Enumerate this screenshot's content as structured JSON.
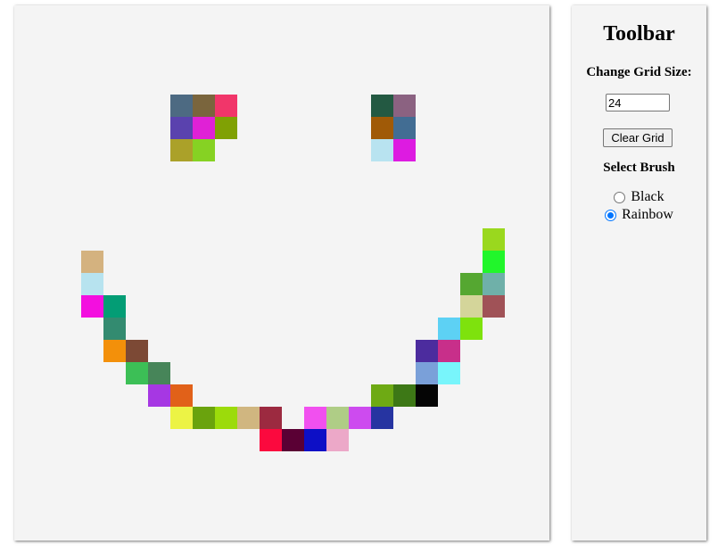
{
  "canvas": {
    "grid_size": 24,
    "background": "#f4f4f4",
    "painted_cells": [
      {
        "row": 4,
        "col": 7,
        "color": "#4d6a82"
      },
      {
        "row": 4,
        "col": 8,
        "color": "#7a653d"
      },
      {
        "row": 4,
        "col": 9,
        "color": "#f1366a"
      },
      {
        "row": 5,
        "col": 7,
        "color": "#5a42ae"
      },
      {
        "row": 5,
        "col": 8,
        "color": "#e021d6"
      },
      {
        "row": 5,
        "col": 9,
        "color": "#80a104"
      },
      {
        "row": 6,
        "col": 7,
        "color": "#aba129"
      },
      {
        "row": 6,
        "col": 8,
        "color": "#86d223"
      },
      {
        "row": 4,
        "col": 16,
        "color": "#235942"
      },
      {
        "row": 4,
        "col": 17,
        "color": "#8b6281"
      },
      {
        "row": 5,
        "col": 16,
        "color": "#a05a07"
      },
      {
        "row": 5,
        "col": 17,
        "color": "#426d93"
      },
      {
        "row": 6,
        "col": 16,
        "color": "#b8e3f0"
      },
      {
        "row": 6,
        "col": 17,
        "color": "#dd1be1"
      },
      {
        "row": 11,
        "col": 3,
        "color": "#d4b27f"
      },
      {
        "row": 12,
        "col": 3,
        "color": "#b7e3ef"
      },
      {
        "row": 13,
        "col": 3,
        "color": "#f30fdf"
      },
      {
        "row": 13,
        "col": 4,
        "color": "#039d75"
      },
      {
        "row": 14,
        "col": 4,
        "color": "#338b70"
      },
      {
        "row": 15,
        "col": 4,
        "color": "#f3900a"
      },
      {
        "row": 15,
        "col": 5,
        "color": "#7c4935"
      },
      {
        "row": 16,
        "col": 5,
        "color": "#3cbf56"
      },
      {
        "row": 16,
        "col": 6,
        "color": "#478559"
      },
      {
        "row": 17,
        "col": 6,
        "color": "#a637e3"
      },
      {
        "row": 17,
        "col": 7,
        "color": "#e16119"
      },
      {
        "row": 18,
        "col": 7,
        "color": "#ecf345"
      },
      {
        "row": 18,
        "col": 8,
        "color": "#6aa30d"
      },
      {
        "row": 18,
        "col": 9,
        "color": "#9cdb0b"
      },
      {
        "row": 18,
        "col": 10,
        "color": "#d0b680"
      },
      {
        "row": 18,
        "col": 11,
        "color": "#9c2a40"
      },
      {
        "row": 19,
        "col": 11,
        "color": "#fb093e"
      },
      {
        "row": 19,
        "col": 12,
        "color": "#5a0034"
      },
      {
        "row": 19,
        "col": 13,
        "color": "#0d0fc6"
      },
      {
        "row": 19,
        "col": 14,
        "color": "#eca8c8"
      },
      {
        "row": 18,
        "col": 13,
        "color": "#f150ef"
      },
      {
        "row": 18,
        "col": 14,
        "color": "#afcd86"
      },
      {
        "row": 18,
        "col": 15,
        "color": "#cd4bef"
      },
      {
        "row": 18,
        "col": 16,
        "color": "#2634a1"
      },
      {
        "row": 17,
        "col": 16,
        "color": "#6eaa14"
      },
      {
        "row": 17,
        "col": 17,
        "color": "#3d7816"
      },
      {
        "row": 17,
        "col": 18,
        "color": "#050505"
      },
      {
        "row": 16,
        "col": 18,
        "color": "#7aa0d9"
      },
      {
        "row": 16,
        "col": 19,
        "color": "#78f5fb"
      },
      {
        "row": 15,
        "col": 18,
        "color": "#4c2c9e"
      },
      {
        "row": 15,
        "col": 19,
        "color": "#c82f8a"
      },
      {
        "row": 14,
        "col": 19,
        "color": "#5dd1f4"
      },
      {
        "row": 14,
        "col": 20,
        "color": "#7ee20d"
      },
      {
        "row": 13,
        "col": 20,
        "color": "#d4d59a"
      },
      {
        "row": 13,
        "col": 21,
        "color": "#a05257"
      },
      {
        "row": 12,
        "col": 20,
        "color": "#55a731"
      },
      {
        "row": 12,
        "col": 21,
        "color": "#6fb0a9"
      },
      {
        "row": 11,
        "col": 21,
        "color": "#21f62b"
      },
      {
        "row": 10,
        "col": 21,
        "color": "#9ad81e"
      }
    ]
  },
  "toolbar": {
    "title": "Toolbar",
    "grid_size_label": "Change Grid Size:",
    "grid_size_value": "24",
    "clear_button_label": "Clear Grid",
    "brush_label": "Select Brush",
    "brush_options": [
      {
        "label": "Black",
        "checked": false
      },
      {
        "label": "Rainbow",
        "checked": true
      }
    ],
    "accent_color": "#0075ff"
  }
}
